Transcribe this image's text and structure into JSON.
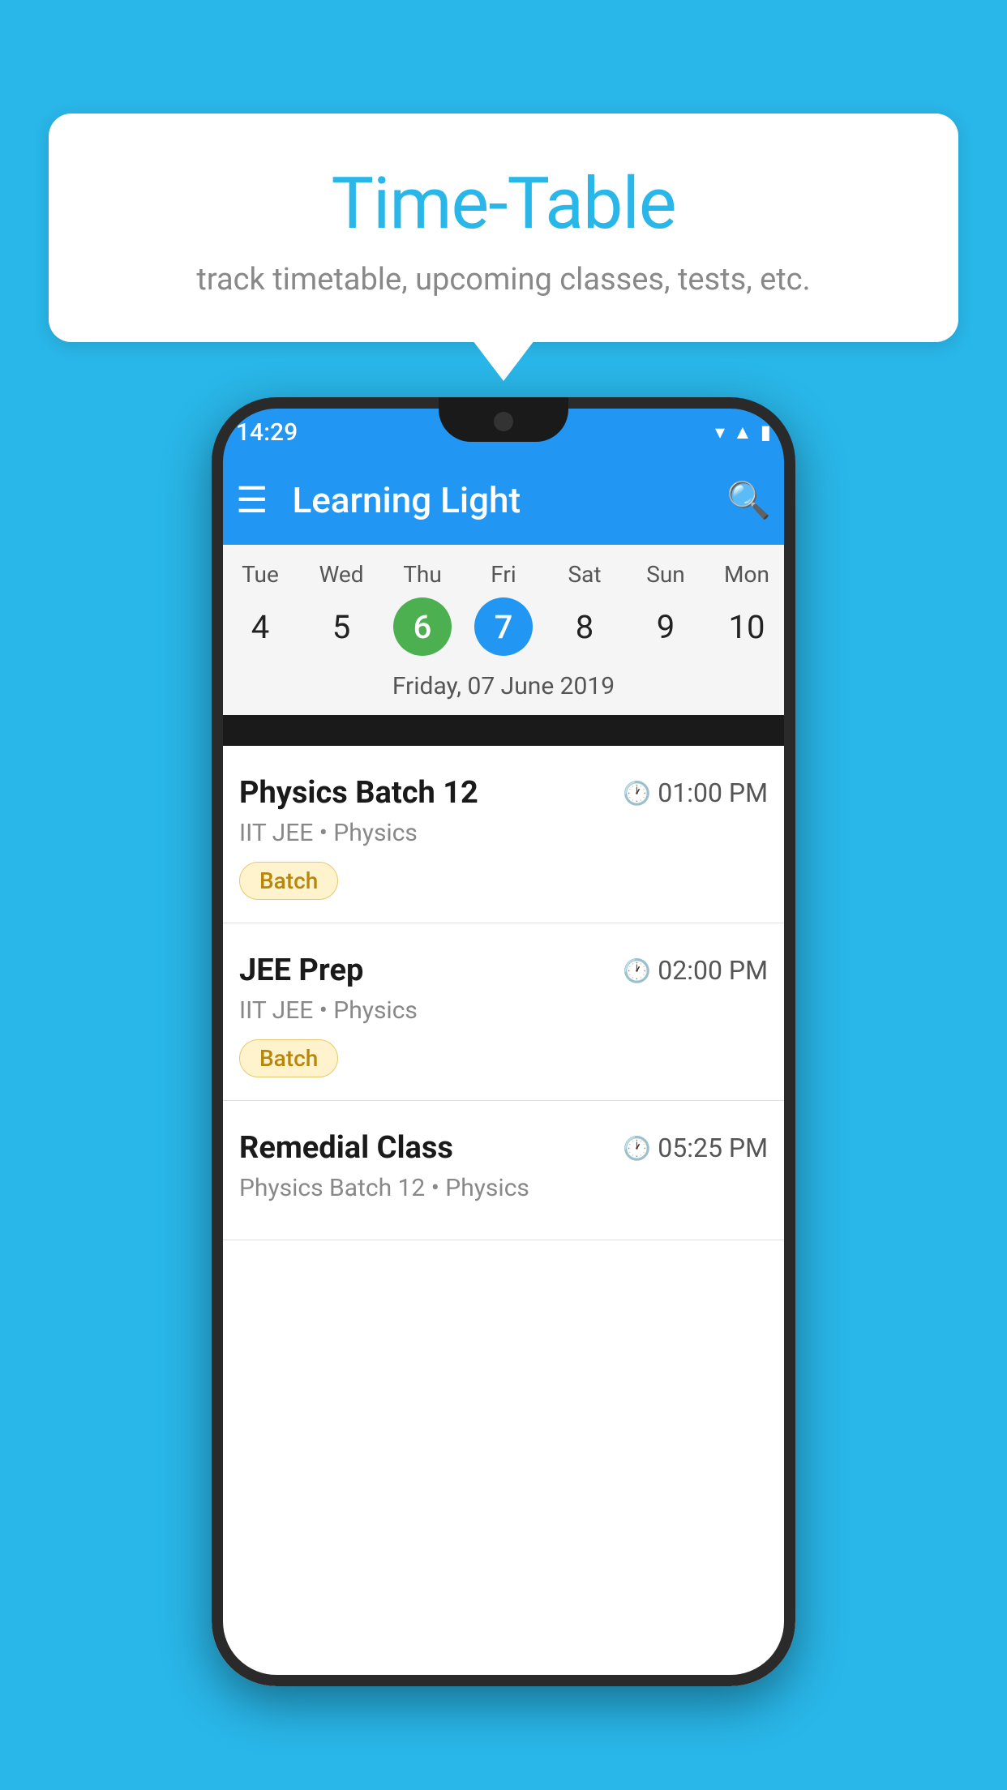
{
  "page": {
    "background_color": "#29b6e8"
  },
  "bubble": {
    "title": "Time-Table",
    "subtitle": "track timetable, upcoming classes, tests, etc."
  },
  "phone": {
    "status_bar": {
      "time": "14:29"
    },
    "app_bar": {
      "title": "Learning Light"
    },
    "calendar": {
      "days": [
        {
          "name": "Tue",
          "num": "4",
          "state": "normal"
        },
        {
          "name": "Wed",
          "num": "5",
          "state": "normal"
        },
        {
          "name": "Thu",
          "num": "6",
          "state": "today"
        },
        {
          "name": "Fri",
          "num": "7",
          "state": "selected"
        },
        {
          "name": "Sat",
          "num": "8",
          "state": "normal"
        },
        {
          "name": "Sun",
          "num": "9",
          "state": "normal"
        },
        {
          "name": "Mon",
          "num": "10",
          "state": "normal"
        }
      ],
      "selected_date": "Friday, 07 June 2019"
    },
    "schedule": [
      {
        "title": "Physics Batch 12",
        "time": "01:00 PM",
        "subtitle": "IIT JEE • Physics",
        "badge": "Batch"
      },
      {
        "title": "JEE Prep",
        "time": "02:00 PM",
        "subtitle": "IIT JEE • Physics",
        "badge": "Batch"
      },
      {
        "title": "Remedial Class",
        "time": "05:25 PM",
        "subtitle": "Physics Batch 12 • Physics",
        "badge": null
      }
    ]
  }
}
